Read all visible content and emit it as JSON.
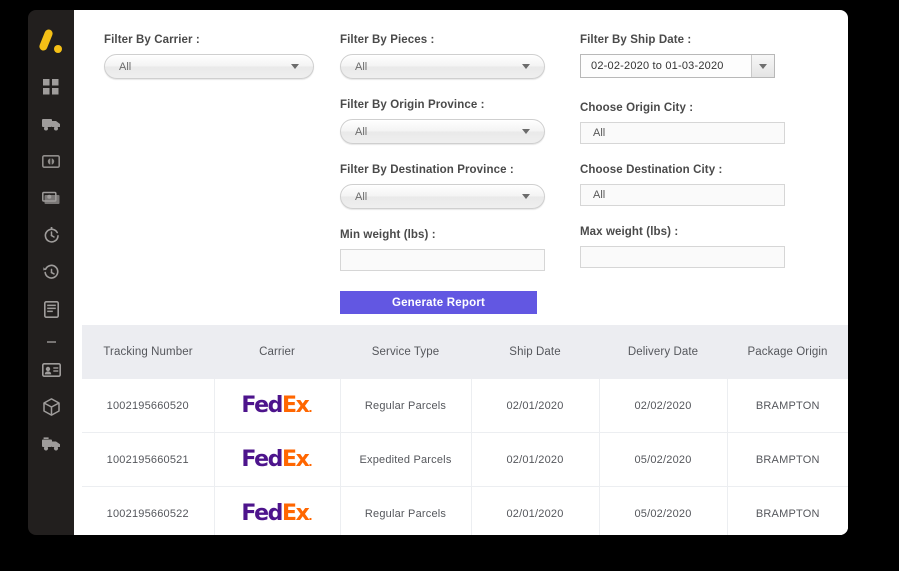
{
  "brand": {
    "logo_name": "app-logo",
    "logo_color": "#F5C016"
  },
  "sidebar": {
    "items": [
      {
        "icon": "dashboard-grid-icon",
        "name": "sidebar-item-dashboard"
      },
      {
        "icon": "truck-icon",
        "name": "sidebar-item-shipments"
      },
      {
        "icon": "money-card-icon",
        "name": "sidebar-item-billing"
      },
      {
        "icon": "cash-stack-icon",
        "name": "sidebar-item-payments"
      },
      {
        "icon": "stopwatch-icon",
        "name": "sidebar-item-tracking"
      },
      {
        "icon": "history-clock-icon",
        "name": "sidebar-item-history"
      },
      {
        "icon": "document-icon",
        "name": "sidebar-item-reports"
      },
      {
        "icon": "separator-dash",
        "name": "sidebar-separator"
      },
      {
        "icon": "id-card-icon",
        "name": "sidebar-item-customers"
      },
      {
        "icon": "package-cube-icon",
        "name": "sidebar-item-packages"
      },
      {
        "icon": "delivery-truck-icon",
        "name": "sidebar-item-delivery"
      }
    ]
  },
  "filters": {
    "carrier": {
      "label": "Filter By Carrier :",
      "value": "All"
    },
    "pieces": {
      "label": "Filter By Pieces :",
      "value": "All"
    },
    "origin_province": {
      "label": "Filter By Origin Province :",
      "value": "All"
    },
    "destination_province": {
      "label": "Filter By Destination Province :",
      "value": "All"
    },
    "ship_date": {
      "label": "Filter By Ship Date :",
      "value": "02-02-2020 to 01-03-2020"
    },
    "origin_city": {
      "label": "Choose Origin City :",
      "value": "All"
    },
    "destination_city": {
      "label": "Choose Destination City :",
      "value": "All"
    },
    "min_weight": {
      "label": "Min weight (lbs) :",
      "value": "",
      "placeholder": ""
    },
    "max_weight": {
      "label": "Max weight (lbs) :",
      "value": "",
      "placeholder": ""
    },
    "generate_button": {
      "label": "Generate Report",
      "color": "#6257E2"
    }
  },
  "table": {
    "columns": [
      "Tracking Number",
      "Carrier",
      "Service Type",
      "Ship Date",
      "Delivery Date",
      "Package Origin"
    ],
    "rows": [
      {
        "tracking_number": "1002195660520",
        "carrier": "FedEx",
        "service_type": "Regular Parcels",
        "ship_date": "02/01/2020",
        "delivery_date": "02/02/2020",
        "package_origin": "BRAMPTON"
      },
      {
        "tracking_number": "1002195660521",
        "carrier": "FedEx",
        "service_type": "Expedited Parcels",
        "ship_date": "02/01/2020",
        "delivery_date": "05/02/2020",
        "package_origin": "BRAMPTON"
      },
      {
        "tracking_number": "1002195660522",
        "carrier": "FedEx",
        "service_type": "Regular Parcels",
        "ship_date": "02/01/2020",
        "delivery_date": "05/02/2020",
        "package_origin": "BRAMPTON"
      }
    ],
    "carrier_logo": {
      "part1": "Fed",
      "part2": "Ex",
      "mark": ".",
      "color1": "#4D148C",
      "color2": "#FF6600"
    }
  }
}
